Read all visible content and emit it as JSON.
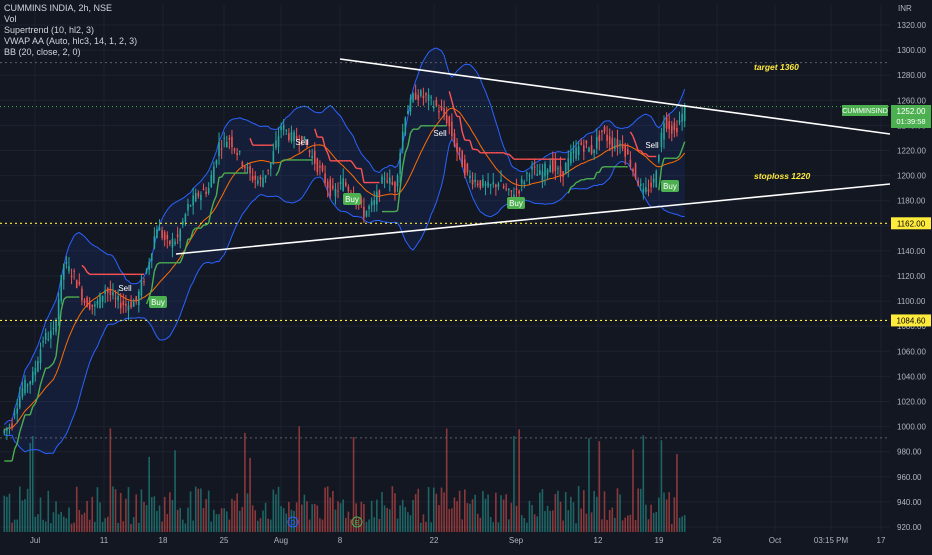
{
  "legend": {
    "symbol_line": "CUMMINS INDIA, 2h, NSE",
    "vol": "Vol",
    "supertrend": "Supertrend (10, hl2, 3)",
    "vwap": "VWAP AA (Auto, hlc3, 14, 1, 2, 3)",
    "bb": "BB (20, close, 2, 0)"
  },
  "currency": "INR",
  "colors": {
    "background": "#131722",
    "up": "#26a69a",
    "down": "#ef5350",
    "bb_band": "#2962ff",
    "bb_basis": "#ff6d00",
    "supertrend_up": "#4caf50",
    "supertrend_down": "#ff5252",
    "hline": "#ffeb3b",
    "trendline": "#ffffff",
    "target_label": "#ffeb3b",
    "symbol_tag": "#4caf50"
  },
  "chart_data": {
    "type": "candlestick",
    "y_range": [
      915,
      1330
    ],
    "y_ticks": [
      "1320.00",
      "1300.00",
      "1280.00",
      "1260.00",
      "1240.00",
      "1220.00",
      "1200.00",
      "1180.00",
      "1160.00",
      "1140.00",
      "1120.00",
      "1100.00",
      "1080.00",
      "1060.00",
      "1040.00",
      "1020.00",
      "1000.00",
      "980.00",
      "960.00",
      "940.00",
      "920.00"
    ],
    "x_ticks": [
      "Jul",
      "11",
      "18",
      "25",
      "Aug",
      "8",
      "22",
      "Sep",
      "12",
      "19",
      "26",
      "Oct",
      "03:15 PM",
      "17"
    ],
    "trendlines": [
      {
        "from": [
          "Aug 9",
          1295
        ],
        "to": [
          "Oct 22",
          1233
        ]
      },
      {
        "from": [
          "Jul 18",
          1138
        ],
        "to": [
          "Oct 22",
          1193
        ]
      }
    ],
    "horizontal_levels": [
      {
        "value": 1162.0,
        "label": "1162.00"
      },
      {
        "value": 1084.6,
        "label": "1084.60"
      }
    ],
    "annotations": [
      {
        "text": "target 1360"
      },
      {
        "text": "stoploss 1220"
      }
    ],
    "signals": [
      {
        "type": "Sell",
        "date": "Jul 15"
      },
      {
        "type": "Buy",
        "date": "Jul 18"
      },
      {
        "type": "Sell",
        "date": "Jul 28"
      },
      {
        "type": "Buy",
        "date": "Aug 7"
      },
      {
        "type": "Sell",
        "date": "Aug 21"
      },
      {
        "type": "Buy",
        "date": "Sep 1"
      },
      {
        "type": "Sell",
        "date": "Sep 19"
      },
      {
        "type": "Buy",
        "date": "Sep 21"
      }
    ],
    "last_price": {
      "symbol": "CUMMINSIND",
      "price": "1252.00",
      "countdown": "01:39:58"
    },
    "price_path": [
      [
        995,
        1003
      ],
      [
        1008,
        1030
      ],
      [
        1030,
        1040
      ],
      [
        1040,
        1070
      ],
      [
        1070,
        1075
      ],
      [
        1075,
        1130
      ],
      [
        1130,
        1120
      ],
      [
        1120,
        1100
      ],
      [
        1100,
        1095
      ],
      [
        1095,
        1110
      ],
      [
        1110,
        1100
      ],
      [
        1100,
        1097
      ],
      [
        1097,
        1100
      ],
      [
        1100,
        1125
      ],
      [
        1125,
        1160
      ],
      [
        1160,
        1145
      ],
      [
        1145,
        1150
      ],
      [
        1150,
        1175
      ],
      [
        1175,
        1185
      ],
      [
        1185,
        1190
      ],
      [
        1190,
        1225
      ],
      [
        1225,
        1230
      ],
      [
        1230,
        1215
      ],
      [
        1215,
        1200
      ],
      [
        1200,
        1195
      ],
      [
        1195,
        1210
      ],
      [
        1210,
        1240
      ],
      [
        1240,
        1230
      ],
      [
        1230,
        1230
      ],
      [
        1230,
        1215
      ],
      [
        1215,
        1200
      ],
      [
        1200,
        1185
      ],
      [
        1185,
        1195
      ],
      [
        1195,
        1185
      ],
      [
        1185,
        1170
      ],
      [
        1170,
        1178
      ],
      [
        1178,
        1200
      ],
      [
        1200,
        1190
      ],
      [
        1190,
        1250
      ],
      [
        1250,
        1265
      ],
      [
        1265,
        1262
      ],
      [
        1262,
        1255
      ],
      [
        1255,
        1245
      ],
      [
        1245,
        1220
      ],
      [
        1220,
        1200
      ],
      [
        1200,
        1195
      ],
      [
        1195,
        1190
      ],
      [
        1190,
        1195
      ],
      [
        1195,
        1185
      ],
      [
        1185,
        1190
      ],
      [
        1190,
        1205
      ],
      [
        1205,
        1200
      ],
      [
        1200,
        1210
      ],
      [
        1210,
        1200
      ],
      [
        1200,
        1215
      ],
      [
        1215,
        1225
      ],
      [
        1225,
        1220
      ],
      [
        1220,
        1235
      ],
      [
        1235,
        1225
      ],
      [
        1225,
        1225
      ],
      [
        1225,
        1205
      ],
      [
        1205,
        1185
      ],
      [
        1185,
        1195
      ],
      [
        1195,
        1245
      ],
      [
        1245,
        1235
      ],
      [
        1235,
        1252
      ]
    ]
  }
}
